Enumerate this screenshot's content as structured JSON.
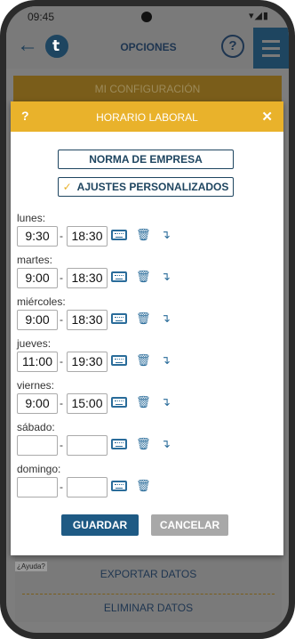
{
  "status_bar": {
    "time": "09:45",
    "indicators": "▾◢▮"
  },
  "app_bar": {
    "title": "OPCIONES",
    "logo_letter": "t",
    "help": "?",
    "back_glyph": "←"
  },
  "background": {
    "config_label": "MI CONFIGURACIÓN",
    "help_tag": "¿Ayuda?",
    "export_label": "EXPORTAR DATOS",
    "delete_label": "ELIMINAR DATOS"
  },
  "dialog": {
    "help": "?",
    "title": "HORARIO LABORAL",
    "close": "✕",
    "option_company": "NORMA DE EMPRESA",
    "option_custom": "AJUSTES PERSONALIZADOS",
    "check": "✓",
    "days": [
      {
        "name": "lunes:",
        "start": "9:30",
        "end": "18:30"
      },
      {
        "name": "martes:",
        "start": "9:00",
        "end": "18:30"
      },
      {
        "name": "miércoles:",
        "start": "9:00",
        "end": "18:30"
      },
      {
        "name": "jueves:",
        "start": "11:00",
        "end": "19:30"
      },
      {
        "name": "viernes:",
        "start": "9:00",
        "end": "15:00"
      },
      {
        "name": "sábado:",
        "start": "",
        "end": ""
      },
      {
        "name": "domingo:",
        "start": "",
        "end": ""
      }
    ],
    "dash": "-",
    "trash_glyph": "🗑",
    "copy_glyph": "↴",
    "save_label": "GUARDAR",
    "cancel_label": "CANCELAR"
  },
  "colors": {
    "accent": "#e9b22b",
    "primary": "#1e4560",
    "icon": "#2a6c9a"
  }
}
